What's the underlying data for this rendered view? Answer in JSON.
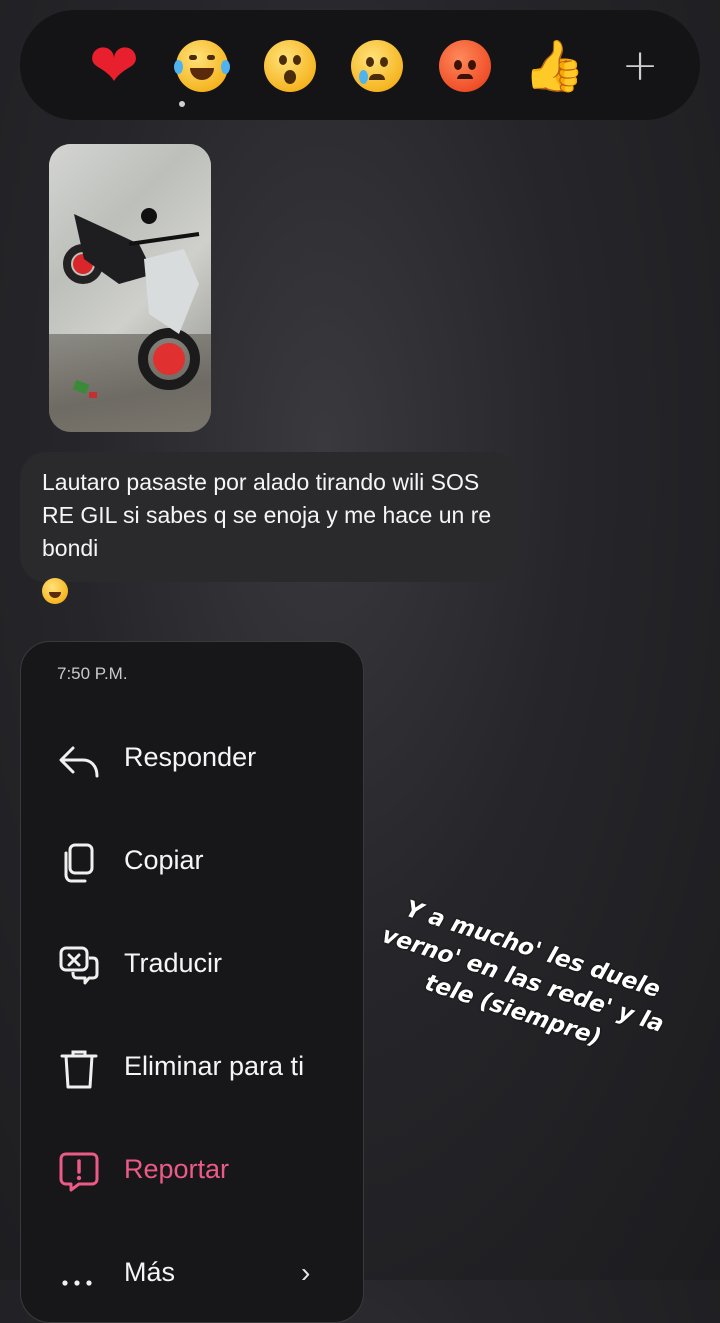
{
  "reactions": [
    {
      "name": "heart"
    },
    {
      "name": "tears-of-joy"
    },
    {
      "name": "surprised"
    },
    {
      "name": "crying"
    },
    {
      "name": "angry"
    },
    {
      "name": "thumbs-up"
    },
    {
      "name": "add-reaction",
      "glyph": "+"
    }
  ],
  "message": {
    "text": "Lautaro pasaste por alado tirando wili SOS RE GIL si sabes q se enoja y me hace un re bondi",
    "reaction_emoji": "tears-of-joy"
  },
  "menu": {
    "time": "7:50 P.M.",
    "items": [
      {
        "label": "Responder",
        "icon": "reply-icon"
      },
      {
        "label": "Copiar",
        "icon": "copy-icon"
      },
      {
        "label": "Traducir",
        "icon": "translate-icon"
      },
      {
        "label": "Eliminar para ti",
        "icon": "trash-icon"
      },
      {
        "label": "Reportar",
        "icon": "report-icon",
        "color": "#ec5a86"
      },
      {
        "label": "Más",
        "icon": "more-icon"
      }
    ]
  },
  "overlay_text": "Y a mucho' les duele verno' en las rede' y la tele (siempre)"
}
